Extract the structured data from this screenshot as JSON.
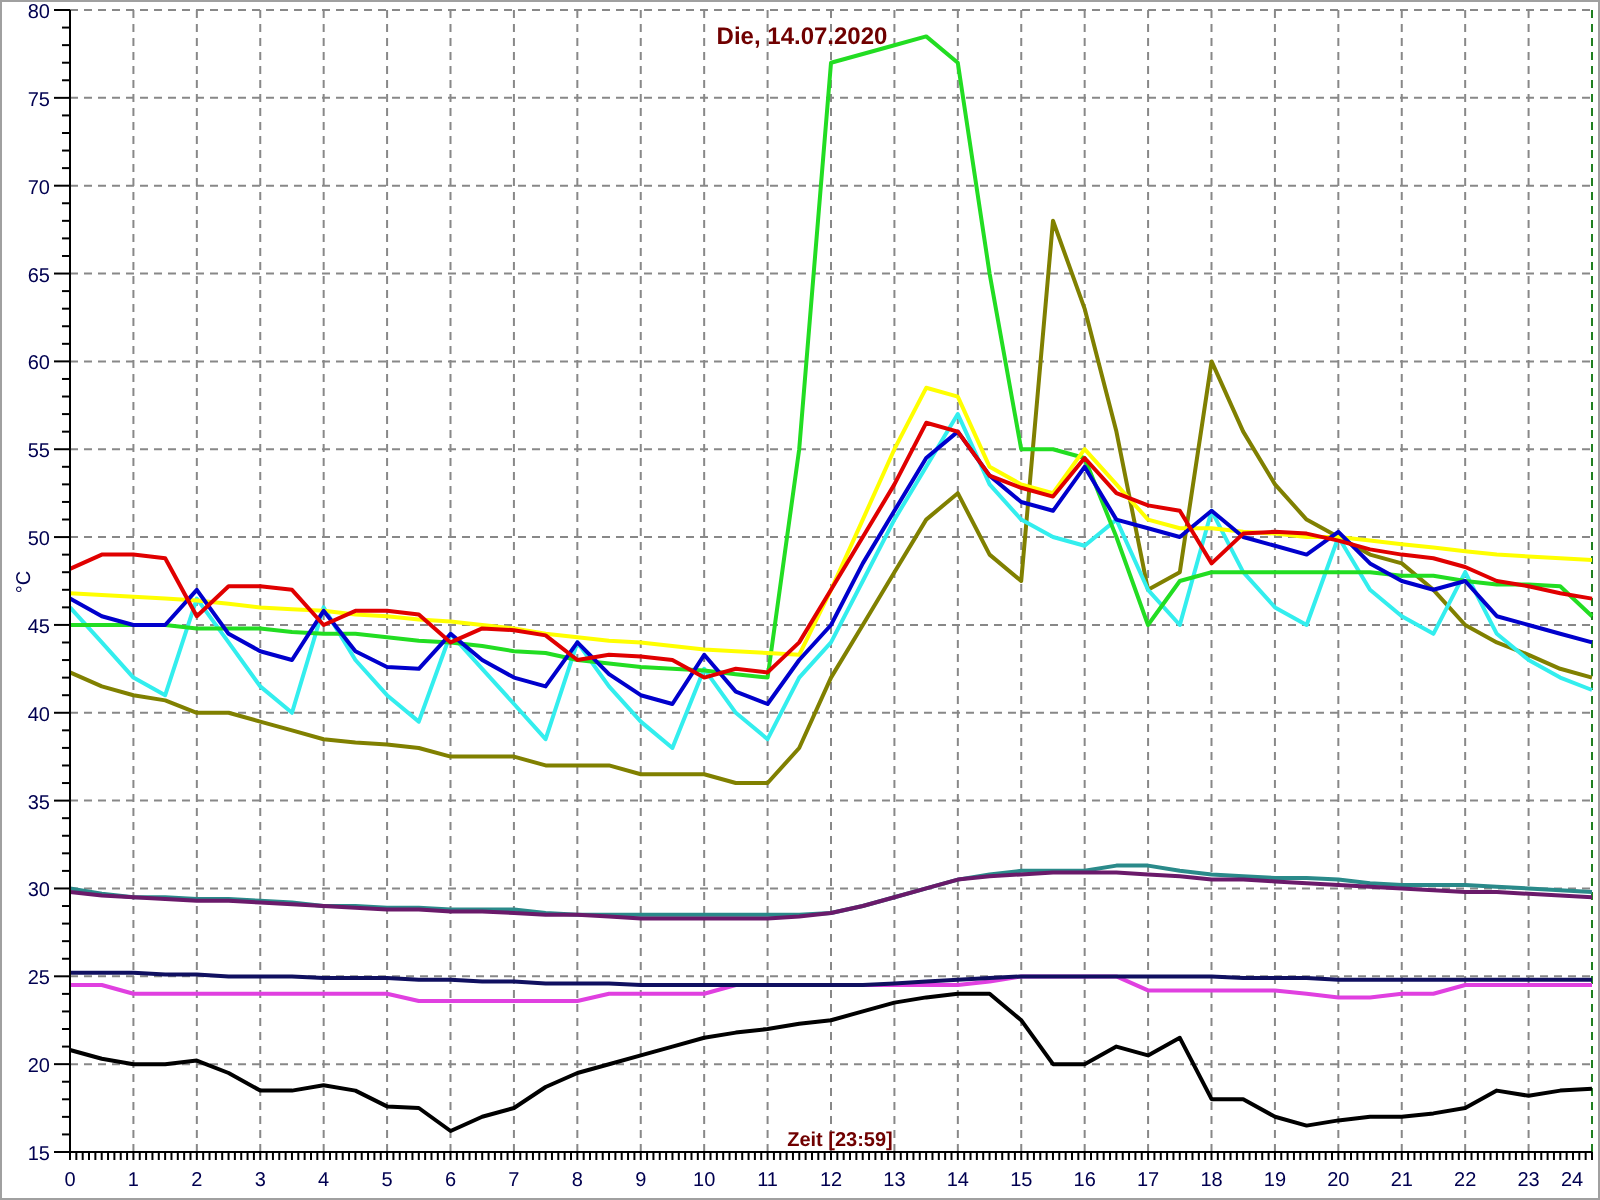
{
  "chart": {
    "chart_data": {
      "type": "line",
      "title": "Die, 14.07.2020",
      "xlabel": "Zeit [23:59]",
      "ylabel": "°C",
      "xlim": [
        0,
        24
      ],
      "grid": true,
      "ylim": [
        15,
        80
      ],
      "xticks": [
        0,
        1,
        2,
        3,
        4,
        5,
        6,
        7,
        8,
        9,
        10,
        11,
        12,
        13,
        14,
        15,
        16,
        17,
        18,
        19,
        20,
        21,
        22,
        23,
        24
      ],
      "yticks": [
        15,
        20,
        25,
        30,
        35,
        40,
        45,
        50,
        55,
        60,
        65,
        70,
        75,
        80
      ],
      "x": [
        0,
        0.5,
        1,
        1.5,
        2,
        2.5,
        3,
        3.5,
        4,
        4.5,
        5,
        5.5,
        6,
        6.5,
        7,
        7.5,
        8,
        8.5,
        9,
        9.5,
        10,
        10.5,
        11,
        11.5,
        12,
        12.5,
        13,
        13.5,
        14,
        14.5,
        15,
        15.5,
        16,
        16.5,
        17,
        17.5,
        18,
        18.5,
        19,
        19.5,
        20,
        20.5,
        21,
        21.5,
        22,
        22.5,
        23,
        23.5,
        24
      ],
      "series": [
        {
          "color": "#2a8a8a",
          "values": [
            30,
            29.7,
            29.5,
            29.5,
            29.4,
            29.4,
            29.3,
            29.2,
            29,
            29,
            28.9,
            28.9,
            28.8,
            28.8,
            28.8,
            28.6,
            28.5,
            28.5,
            28.5,
            28.5,
            28.5,
            28.5,
            28.5,
            28.5,
            28.6,
            29,
            29.5,
            30,
            30.5,
            30.8,
            31,
            31,
            31,
            31.3,
            31.3,
            31,
            30.8,
            30.7,
            30.6,
            30.6,
            30.5,
            30.3,
            30.2,
            30.2,
            30.2,
            30.1,
            30,
            29.9,
            29.8
          ]
        },
        {
          "color": "#6a1a6a",
          "values": [
            29.8,
            29.6,
            29.5,
            29.4,
            29.3,
            29.3,
            29.2,
            29.1,
            29,
            28.9,
            28.8,
            28.8,
            28.7,
            28.7,
            28.6,
            28.5,
            28.5,
            28.4,
            28.3,
            28.3,
            28.3,
            28.3,
            28.3,
            28.4,
            28.6,
            29,
            29.5,
            30,
            30.5,
            30.7,
            30.8,
            30.9,
            30.9,
            30.9,
            30.8,
            30.7,
            30.5,
            30.5,
            30.4,
            30.3,
            30.2,
            30.1,
            30,
            29.9,
            29.8,
            29.8,
            29.7,
            29.6,
            29.5
          ]
        },
        {
          "color": "#e040e0",
          "values": [
            24.5,
            24.5,
            24,
            24,
            24,
            24,
            24,
            24,
            24,
            24,
            24,
            23.6,
            23.6,
            23.6,
            23.6,
            23.6,
            23.6,
            24,
            24,
            24,
            24,
            24.5,
            24.5,
            null,
            24.5,
            null,
            24.5,
            24.5,
            24.5,
            24.7,
            25,
            null,
            25,
            25,
            24.2,
            24.2,
            24.2,
            24.2,
            24.2,
            24,
            23.8,
            23.8,
            24,
            24,
            24.5,
            24.5,
            24.5,
            24.5,
            24.5
          ]
        },
        {
          "color": "#101060",
          "values": [
            25.2,
            25.2,
            25.2,
            25.1,
            25.1,
            25,
            25,
            25,
            24.9,
            24.9,
            24.9,
            24.8,
            24.8,
            24.7,
            24.7,
            24.6,
            24.6,
            24.6,
            24.5,
            24.5,
            24.5,
            24.5,
            24.5,
            24.5,
            24.5,
            24.5,
            24.6,
            24.7,
            24.8,
            24.9,
            25,
            25,
            25,
            25,
            25,
            25,
            25,
            24.9,
            24.9,
            24.9,
            24.8,
            24.8,
            24.8,
            24.8,
            24.8,
            24.8,
            24.8,
            24.8,
            24.8
          ]
        },
        {
          "color": "#000000",
          "values": [
            20.8,
            20.3,
            20,
            20,
            20.2,
            19.5,
            18.5,
            18.5,
            18.8,
            18.5,
            17.6,
            17.5,
            16.2,
            17,
            17.5,
            18.7,
            19.5,
            20,
            20.5,
            21,
            21.5,
            21.8,
            22,
            22.3,
            22.5,
            23,
            23.5,
            23.8,
            24,
            24,
            22.5,
            20,
            20,
            21,
            20.5,
            21.5,
            18,
            18,
            17,
            16.5,
            16.8,
            17,
            17,
            17.2,
            17.5,
            18.5,
            18.2,
            18.5,
            18.6
          ]
        },
        {
          "color": "#808000",
          "values": [
            42.3,
            41.5,
            41,
            40.7,
            40,
            40,
            39.5,
            39,
            38.5,
            38.3,
            38.2,
            38,
            37.5,
            37.5,
            37.5,
            37,
            37,
            37,
            36.5,
            36.5,
            36.5,
            36,
            36,
            38,
            42,
            45,
            48,
            51,
            52.5,
            49,
            47.5,
            68,
            63,
            56,
            47,
            48,
            60,
            56,
            53,
            51,
            50,
            49,
            48.5,
            47,
            45,
            44,
            43.3,
            42.5,
            42
          ]
        },
        {
          "color": "#33eeee",
          "values": [
            46,
            44,
            42,
            41,
            46.5,
            44,
            41.5,
            40,
            46,
            43,
            41,
            39.5,
            44.5,
            42.5,
            40.5,
            38.5,
            44,
            41.5,
            39.5,
            38,
            42.5,
            40,
            38.5,
            42,
            44,
            47.5,
            51,
            54,
            57,
            53,
            51,
            50,
            49.5,
            51,
            47,
            45,
            51.5,
            48,
            46,
            45,
            50,
            47,
            45.5,
            44.5,
            48,
            44.5,
            43,
            42,
            41.3
          ]
        },
        {
          "color": "#22dd22",
          "values": [
            45,
            45,
            45,
            45,
            44.8,
            44.8,
            44.8,
            44.6,
            44.5,
            44.5,
            44.3,
            44.1,
            44,
            43.8,
            43.5,
            43.4,
            43,
            42.8,
            42.6,
            42.5,
            42.4,
            42.2,
            42,
            55,
            77,
            77.5,
            78,
            78.5,
            77,
            65,
            55,
            55,
            54.5,
            50,
            45,
            47.5,
            48,
            48,
            48,
            48,
            48,
            48,
            47.8,
            47.8,
            47.5,
            47.3,
            47.3,
            47.2,
            45.5
          ]
        },
        {
          "color": "#ffff00",
          "values": [
            46.8,
            46.7,
            46.6,
            46.5,
            46.4,
            46.2,
            46,
            45.9,
            45.8,
            45.6,
            45.5,
            45.3,
            45.2,
            45,
            44.8,
            44.5,
            44.3,
            44.1,
            44,
            43.8,
            43.6,
            43.5,
            43.4,
            43.3,
            47,
            51,
            55,
            58.5,
            58,
            54,
            53,
            52.5,
            55,
            53,
            51,
            50.5,
            50.5,
            50.3,
            50.2,
            50,
            50,
            49.8,
            49.6,
            49.4,
            49.2,
            49,
            48.9,
            48.8,
            48.7
          ]
        },
        {
          "color": "#0000cc",
          "values": [
            46.5,
            45.5,
            45,
            45,
            47,
            44.5,
            43.5,
            43,
            45.8,
            43.5,
            42.6,
            42.5,
            44.5,
            43,
            42,
            41.5,
            44,
            42.2,
            41,
            40.5,
            43.3,
            41.2,
            40.5,
            43,
            45,
            48.5,
            51.5,
            54.5,
            56,
            53.5,
            52,
            51.5,
            54,
            51,
            50.5,
            50,
            51.5,
            50,
            49.5,
            49,
            50.3,
            48.5,
            47.5,
            47,
            47.5,
            45.5,
            45,
            44.5,
            44
          ]
        },
        {
          "color": "#e00000",
          "values": [
            48.2,
            49,
            49,
            48.8,
            45.5,
            47.2,
            47.2,
            47,
            45,
            45.8,
            45.8,
            45.6,
            44,
            44.8,
            44.7,
            44.4,
            43,
            43.3,
            43.2,
            43,
            42,
            42.5,
            42.3,
            44,
            47,
            50,
            53,
            56.5,
            56,
            53.5,
            52.8,
            52.3,
            54.5,
            52.5,
            51.8,
            51.5,
            48.5,
            50.2,
            50.3,
            50.2,
            49.8,
            49.3,
            49,
            48.8,
            48.3,
            47.5,
            47.2,
            46.8,
            46.5
          ]
        }
      ]
    }
  }
}
